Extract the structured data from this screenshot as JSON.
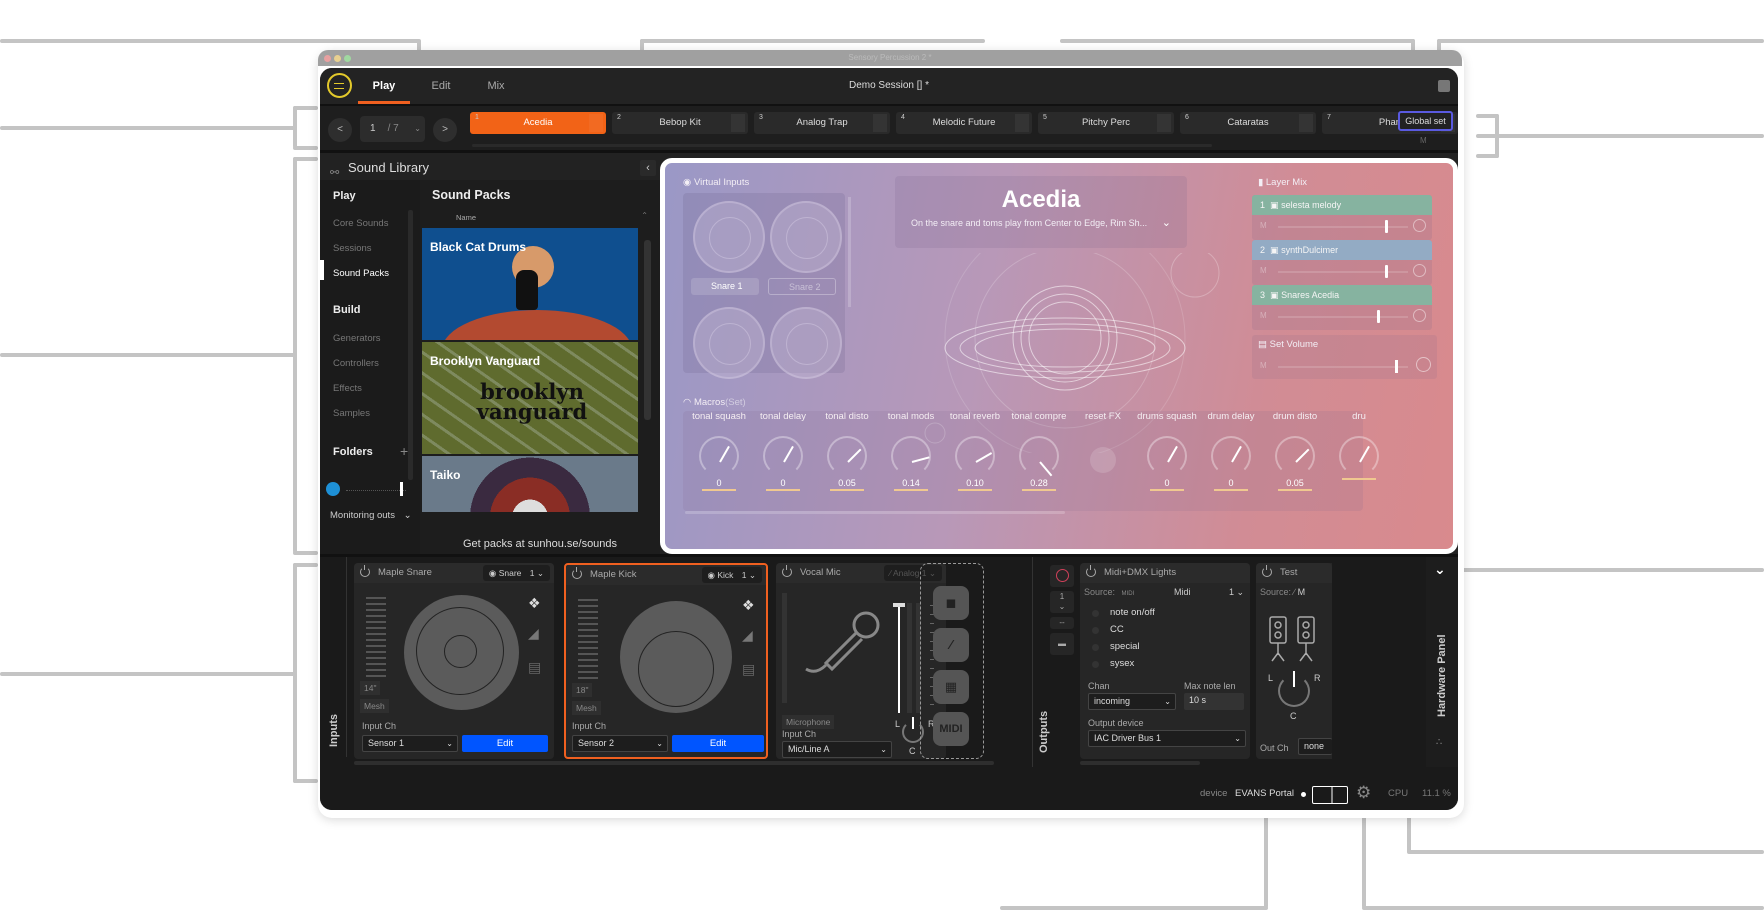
{
  "window": {
    "title": "Sensory Percussion 2 *"
  },
  "header": {
    "tabs": [
      {
        "label": "Play",
        "active": true
      },
      {
        "label": "Edit"
      },
      {
        "label": "Mix"
      }
    ],
    "session": "Demo Session [] *"
  },
  "transport": {
    "prev_label": "<",
    "next_label": ">",
    "page": "1",
    "page_total": "/ 7",
    "sets": [
      {
        "num": "1",
        "name": "Acedia",
        "active": true
      },
      {
        "num": "2",
        "name": "Bebop Kit"
      },
      {
        "num": "3",
        "name": "Analog Trap"
      },
      {
        "num": "4",
        "name": "Melodic Future"
      },
      {
        "num": "5",
        "name": "Pitchy Perc"
      },
      {
        "num": "6",
        "name": "Cataratas"
      },
      {
        "num": "7",
        "name": "Phan"
      }
    ],
    "global_set": "Global set",
    "global_mute": "M"
  },
  "sound_library": {
    "title": "Sound Library",
    "nav": {
      "play_heading": "Play",
      "play_items": [
        "Core Sounds",
        "Sessions",
        "Sound Packs"
      ],
      "build_heading": "Build",
      "build_items": [
        "Generators",
        "Controllers",
        "Effects",
        "Samples"
      ],
      "folders_heading": "Folders",
      "add_label": "+",
      "active": "Sound Packs"
    },
    "packs": {
      "title": "Sound Packs",
      "column": "Name",
      "items": [
        "Black Cat Drums",
        "Brooklyn Vanguard",
        "Taiko"
      ],
      "brooklyn_art_text": "brooklyn vanguard",
      "footer": "Get packs at sunhou.se/sounds"
    },
    "monitoring": "Monitoring outs"
  },
  "set_view": {
    "virtual_inputs": {
      "label": "Virtual Inputs",
      "chips": [
        "Snare 1",
        "Snare 2"
      ]
    },
    "title": "Acedia",
    "description": "On the snare and toms play from Center to Edge, Rim Sh...",
    "layer_mix": {
      "label": "Layer Mix",
      "layers": [
        {
          "num": "1",
          "name": "selesta melody",
          "mute": "M",
          "level": 0.82,
          "color": "#86b3a0"
        },
        {
          "num": "2",
          "name": "synthDulcimer",
          "mute": "M",
          "level": 0.82,
          "color": "#93abc4"
        },
        {
          "num": "3",
          "name": "Snares Acedia",
          "mute": "M",
          "level": 0.76,
          "color": "#86b3a0"
        }
      ]
    },
    "set_volume": {
      "label": "Set Volume",
      "mute": "M",
      "level": 0.9
    },
    "macros": {
      "label": "Macros",
      "scope": "(Set)",
      "items": [
        {
          "name": "tonal squash",
          "value": "0",
          "angle": -150
        },
        {
          "name": "tonal delay",
          "value": "0",
          "angle": -150
        },
        {
          "name": "tonal disto",
          "value": "0.05",
          "angle": -135
        },
        {
          "name": "tonal mods",
          "value": "0.14",
          "angle": -105
        },
        {
          "name": "tonal reverb",
          "value": "0.10",
          "angle": -120
        },
        {
          "name": "tonal compre",
          "value": "0.28",
          "angle": -40
        },
        {
          "name": "reset FX",
          "value": "",
          "button": true
        },
        {
          "name": "drums squash",
          "value": "0",
          "angle": -150
        },
        {
          "name": "drum delay",
          "value": "0",
          "angle": -150
        },
        {
          "name": "drum disto",
          "value": "0.05",
          "angle": -135
        },
        {
          "name": "dru",
          "value": "",
          "angle": -150
        }
      ]
    }
  },
  "hardware": {
    "inputs_label": "Inputs",
    "outputs_label": "Outputs",
    "panel_label": "Hardware Panel",
    "inputs": [
      {
        "name": "Maple Snare",
        "type": "Snare",
        "num": "1",
        "size": "14\"",
        "head": "Mesh",
        "input_ch_label": "Input Ch",
        "input_ch": "Sensor 1",
        "edit": "Edit"
      },
      {
        "name": "Maple Kick",
        "type": "Kick",
        "num": "1",
        "size": "18\"",
        "head": "Mesh",
        "input_ch_label": "Input Ch",
        "input_ch": "Sensor 2",
        "edit": "Edit",
        "selected": true
      },
      {
        "name": "Vocal Mic",
        "type": "Analog",
        "num": "1",
        "source": "Microphone",
        "input_ch_label": "Input Ch",
        "input_ch": "Mic/Line A",
        "pan_l": "L",
        "pan_r": "R",
        "pan_c": "C"
      }
    ],
    "add_buttons": [
      "drum-add",
      "analog-add",
      "pad-add",
      "MIDI"
    ],
    "output_controls": {
      "num": "1",
      "dash": "--"
    },
    "outputs": [
      {
        "name": "Midi+DMX Lights",
        "source_label": "Source:",
        "source": "Midi",
        "num": "1",
        "options": [
          "note on/off",
          "CC",
          "special",
          "sysex"
        ],
        "chan_label": "Chan",
        "chan": "incoming",
        "max_len_label": "Max note len",
        "max_len": "10 s",
        "device_label": "Output device",
        "device": "IAC Driver Bus 1"
      },
      {
        "name": "Test",
        "source_label": "Source:",
        "source": "M",
        "pan_l": "L",
        "pan_r": "R",
        "pan_c": "C",
        "out_ch_label": "Out Ch",
        "out_ch": "none"
      }
    ]
  },
  "status": {
    "device_label": "device",
    "device": "EVANS Portal",
    "cpu_label": "CPU",
    "cpu": "11.1 %"
  },
  "colors": {
    "accent": "#f26317",
    "edit_blue": "#0055ff",
    "logo": "#e3c92b",
    "global_set_border": "#5a5ae0"
  }
}
